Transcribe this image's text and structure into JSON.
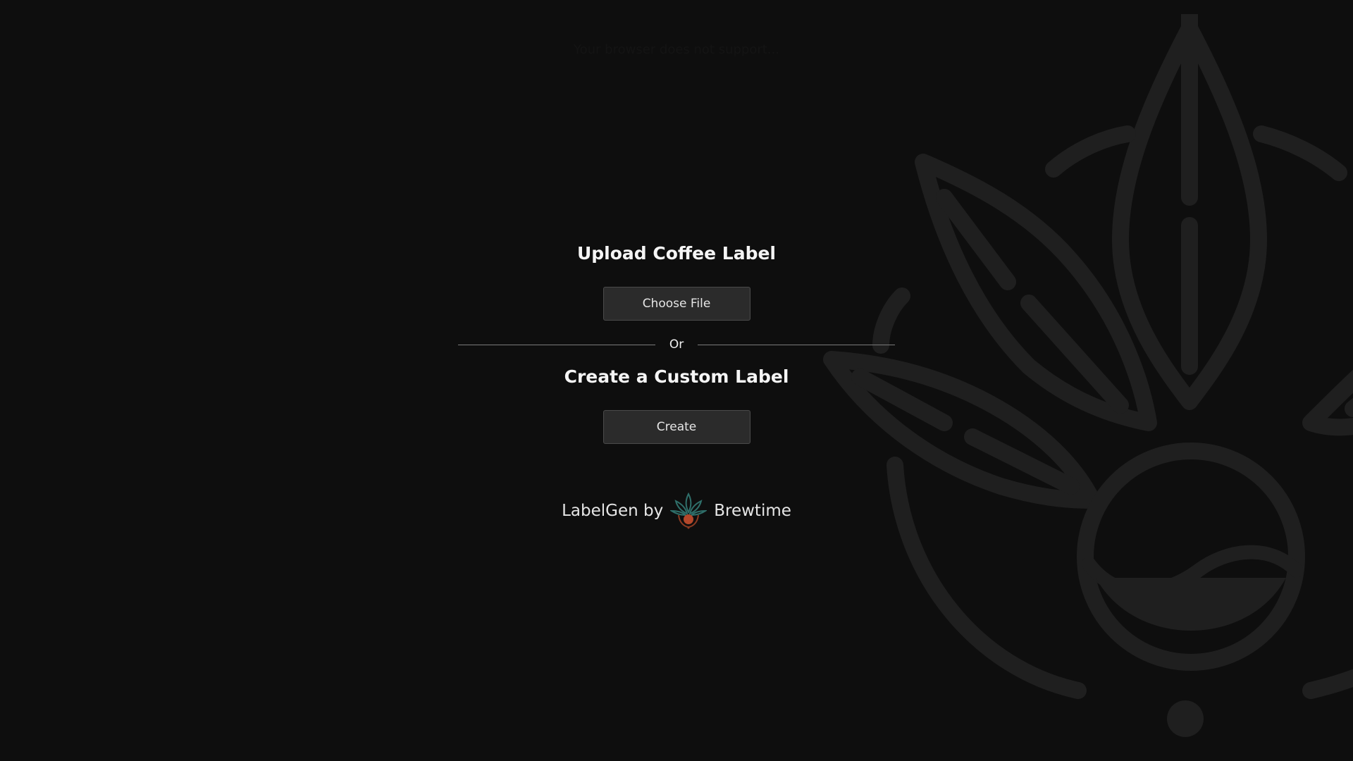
{
  "top_hint": "Your browser does not support...",
  "upload": {
    "heading": "Upload Coffee Label",
    "button_label": "Choose File"
  },
  "divider": {
    "label": "Or"
  },
  "create": {
    "heading": "Create a Custom Label",
    "button_label": "Create"
  },
  "footer": {
    "product": "LabelGen by",
    "brand": "Brewtime",
    "logo_icon": "brewtime-leaf-cup-icon"
  },
  "colors": {
    "background": "#0e0e0e",
    "watermark": "#1f1f1f",
    "button_bg": "#2b2b2b",
    "button_border": "#4a4a4a",
    "logo_leaf": "#2f6f6a",
    "logo_cup": "#b4472a"
  }
}
